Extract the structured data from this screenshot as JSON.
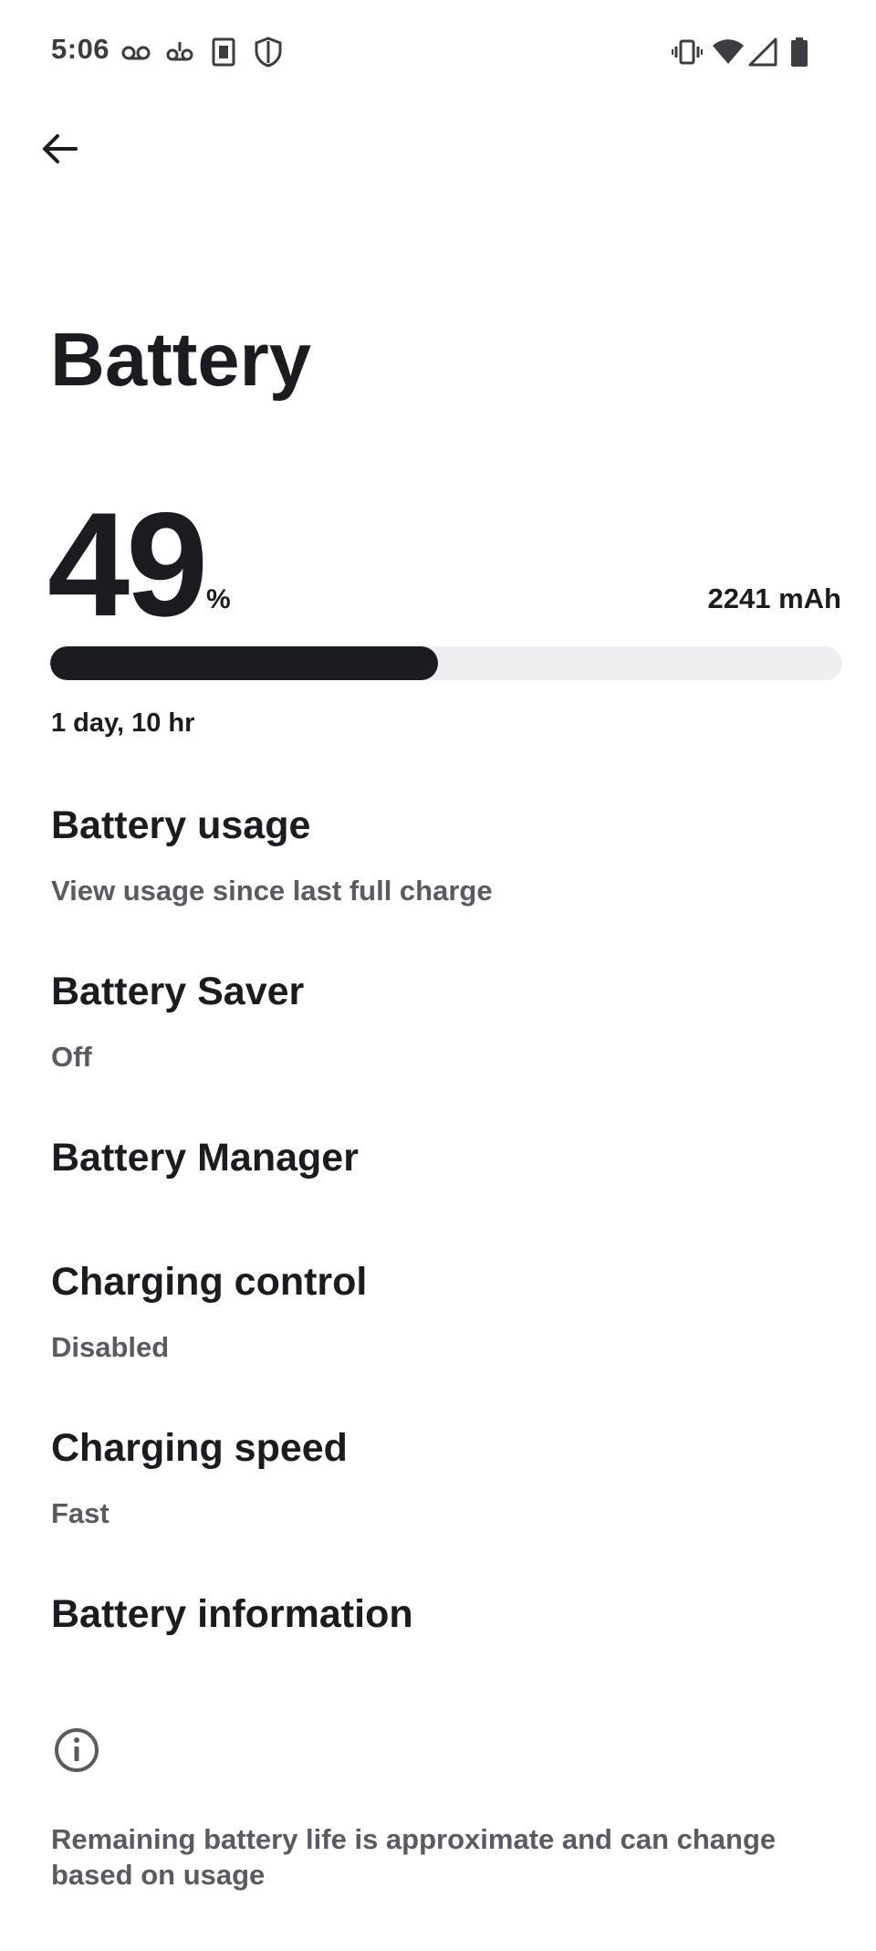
{
  "status_bar": {
    "time": "5:06",
    "icons_left": [
      "voicemail-icon",
      "voicemail-alt-icon",
      "sim-card-icon",
      "shield-icon"
    ],
    "icons_right": [
      "vibrate-icon",
      "wifi-icon",
      "cell-signal-icon",
      "battery-icon"
    ]
  },
  "header": {
    "back_icon": "arrow-back-icon",
    "title": "Battery"
  },
  "battery": {
    "level": "49",
    "percent_sign": "%",
    "level_fraction": 0.49,
    "capacity": "2241 mAh",
    "estimate": "1 day, 10 hr"
  },
  "preferences": [
    {
      "title": "Battery usage",
      "summary": "View usage since last full charge"
    },
    {
      "title": "Battery Saver",
      "summary": "Off"
    },
    {
      "title": "Battery Manager",
      "summary": ""
    },
    {
      "title": "Charging control",
      "summary": "Disabled"
    },
    {
      "title": "Charging speed",
      "summary": "Fast"
    },
    {
      "title": "Battery information",
      "summary": ""
    }
  ],
  "footer": {
    "icon": "info-icon",
    "text": "Remaining battery life is approximate and can change based on usage"
  },
  "colors": {
    "primary_text": "#1b1c1f",
    "secondary_text": "#5a5b60",
    "bar_track": "#efeff1",
    "bar_fill": "#1b1c1f",
    "background": "#ffffff"
  }
}
